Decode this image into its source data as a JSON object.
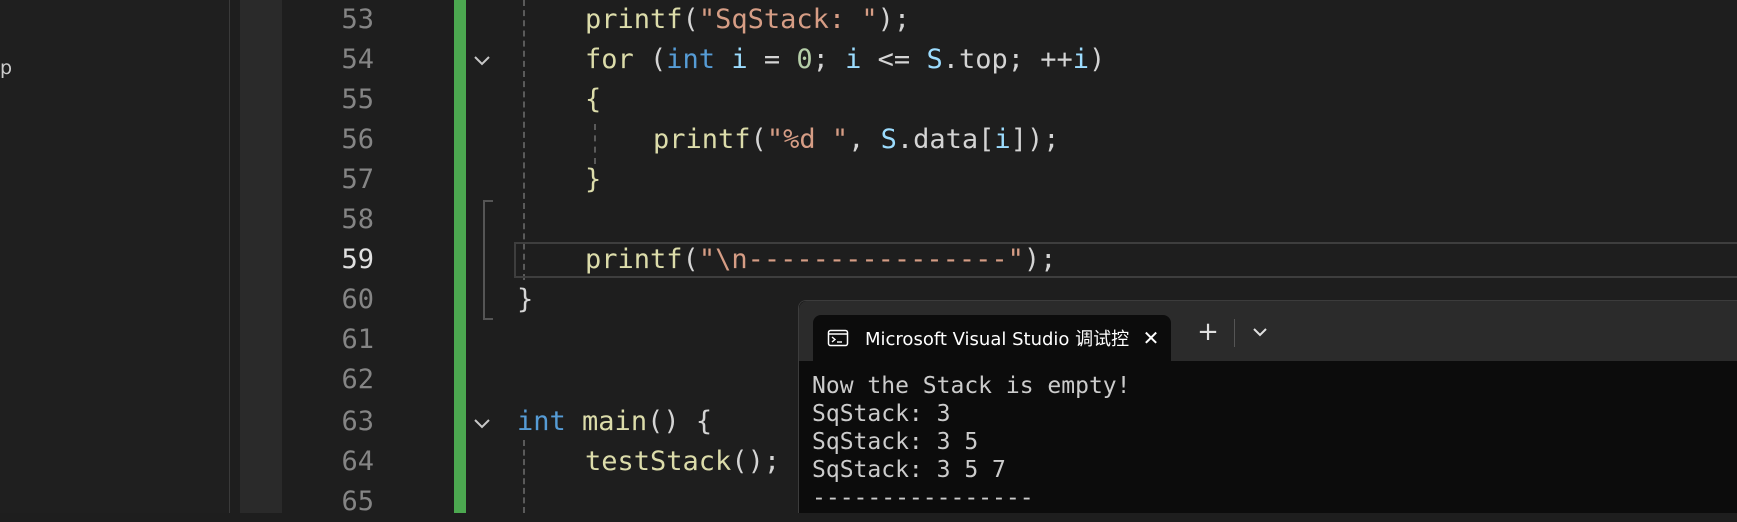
{
  "left_panel": {
    "fragment_text": "p"
  },
  "editor": {
    "line_numbers": [
      "53",
      "54",
      "55",
      "56",
      "57",
      "58",
      "59",
      "60",
      "61",
      "62",
      "63",
      "64",
      "65"
    ],
    "active_line": "59",
    "code": {
      "l53": {
        "fn": "printf",
        "open": "(",
        "str": "\"SqStack: \"",
        "close": ");"
      },
      "l54": {
        "kw": "for",
        "p1": " (",
        "kw2": "int",
        "v1": " i",
        "p2": " = ",
        "n1": "0",
        "p3": "; ",
        "v2": "i",
        "p4": " <= ",
        "v3": "S",
        "p5": ".top; ++",
        "v4": "i",
        "p6": ")"
      },
      "l55": {
        "text": "{"
      },
      "l56": {
        "fn": "printf",
        "open": "(",
        "str": "\"%d \"",
        "p1": ", ",
        "v1": "S",
        "p2": ".data[",
        "v2": "i",
        "p3": "]);"
      },
      "l57": {
        "text": "}"
      },
      "l59": {
        "fn": "printf",
        "open": "(",
        "str": "\"\\n----------------\"",
        "close": ");"
      },
      "l60": {
        "text": "}"
      },
      "l63": {
        "kw": "int",
        "sp": " ",
        "fn": "main",
        "rest": "() {"
      },
      "l64": {
        "fn": "testStack",
        "rest": "();"
      }
    }
  },
  "console": {
    "tab_title": "Microsoft Visual Studio 调试控制台",
    "close_glyph": "✕",
    "new_tab_glyph": "+",
    "output": [
      "Now the Stack is empty!",
      "SqStack: 3",
      "SqStack: 3 5",
      "SqStack: 3 5 7",
      "----------------"
    ]
  },
  "colors": {
    "editor_bg": "#1e1e1e",
    "change_bar": "#4ca850",
    "function": "#dcdcaa",
    "string": "#d69d85",
    "keyword": "#569cd6",
    "variable": "#9cdcfe"
  }
}
